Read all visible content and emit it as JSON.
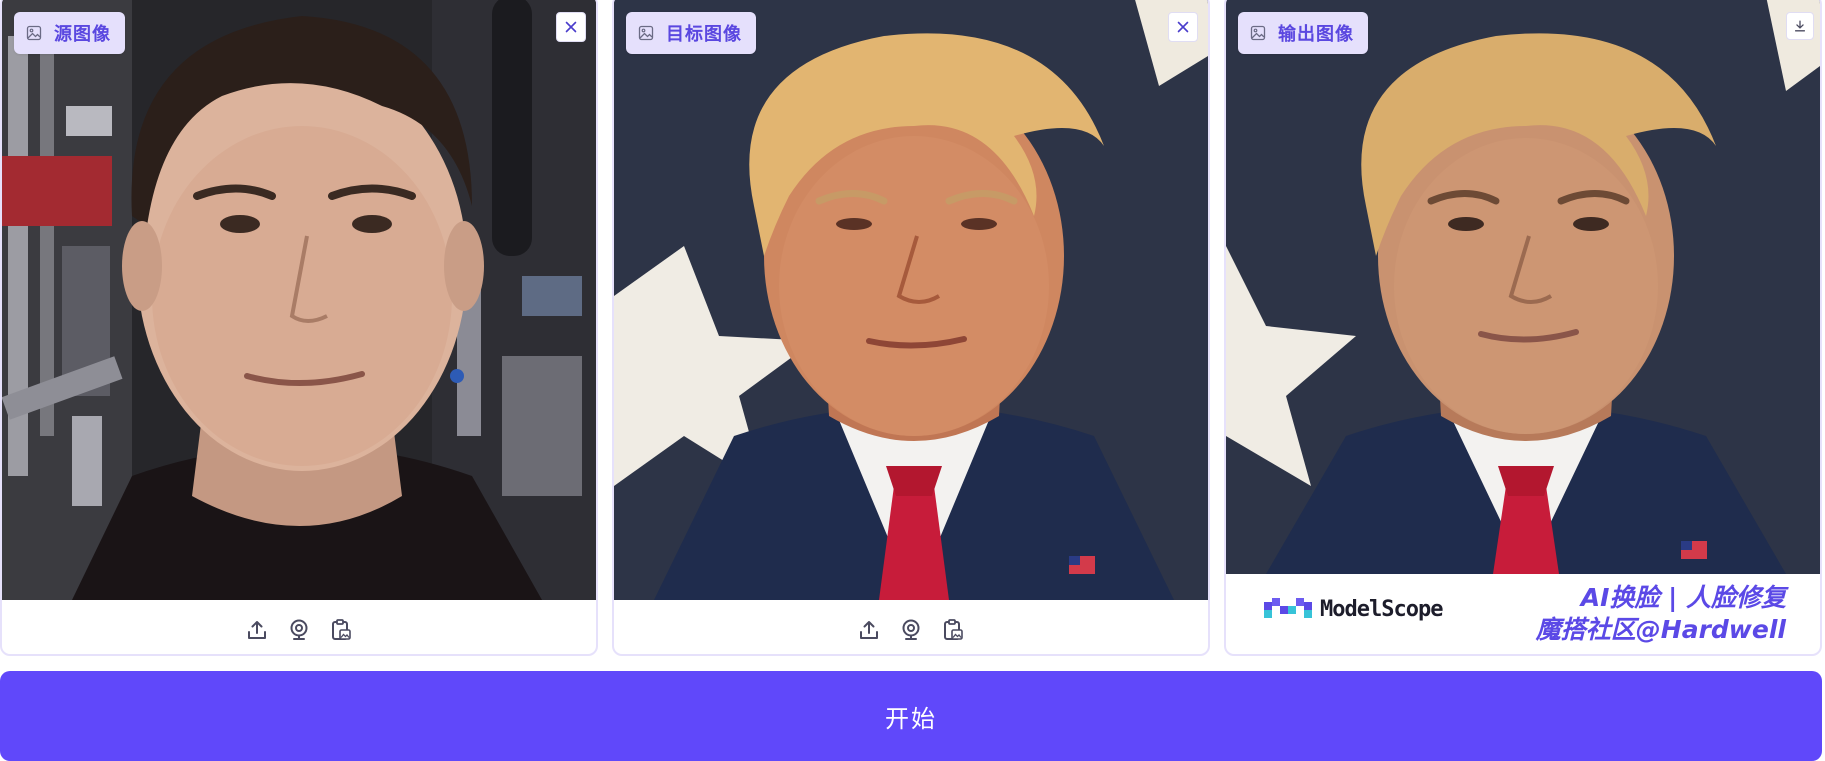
{
  "panels": {
    "source": {
      "label": "源图像"
    },
    "target": {
      "label": "目标图像"
    },
    "output": {
      "label": "输出图像"
    }
  },
  "watermark": {
    "brand": "ModelScope",
    "slogan_line1": "AI换脸 | 人脸修复",
    "slogan_line2": "魔搭社区@Hardwell"
  },
  "start_button": {
    "label": "开始"
  },
  "colors": {
    "accent": "#6048fa",
    "badge_bg": "#e5e0fc",
    "badge_text": "#5a47e0",
    "panel_border": "#e6e1fb"
  },
  "icons": {
    "badge": "image-icon",
    "toolbar": [
      "upload-icon",
      "webcam-icon",
      "clipboard-image-icon"
    ],
    "close": "close-icon",
    "download": "download-icon"
  }
}
